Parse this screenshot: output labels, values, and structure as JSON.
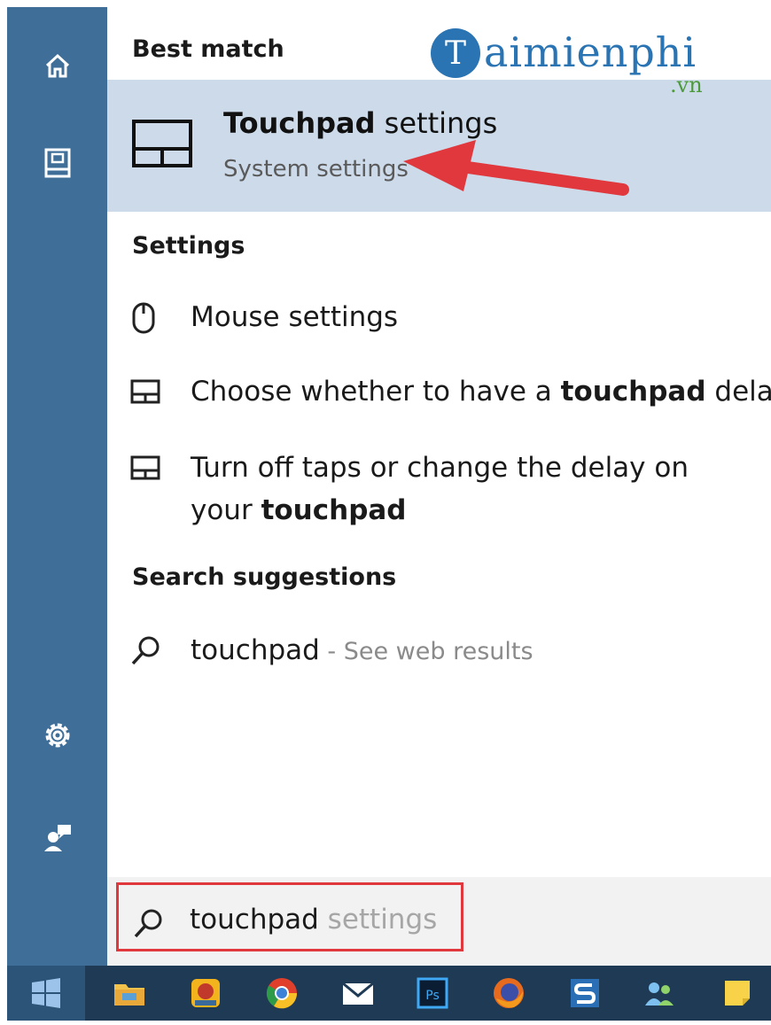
{
  "watermark": {
    "text": "aimienphi",
    "initial": "T",
    "suffix": ".vn"
  },
  "best_match": {
    "heading": "Best match",
    "title_bold": "Touchpad",
    "title_rest": " settings",
    "subtitle": "System settings",
    "icon": "touchpad-icon"
  },
  "settings": {
    "heading": "Settings",
    "items": [
      {
        "icon": "mouse-icon",
        "text": "Mouse settings"
      },
      {
        "icon": "touchpad-small-icon",
        "pre": "Choose whether to have a ",
        "bold": "touchpad",
        "post": " delay"
      },
      {
        "icon": "touchpad-small-icon",
        "line1": "Turn off taps or change the delay on",
        "pre2": "your ",
        "bold2": "touchpad"
      }
    ]
  },
  "suggestions": {
    "heading": "Search suggestions",
    "query": "touchpad",
    "sep": " - ",
    "hint": "See web results"
  },
  "search": {
    "typed": "touchpad",
    "ghost": " settings"
  },
  "colors": {
    "rail": "#3f6f98",
    "selected": "#ccdaea",
    "arrow": "#e0383c",
    "taskbar": "#1f3a55"
  }
}
